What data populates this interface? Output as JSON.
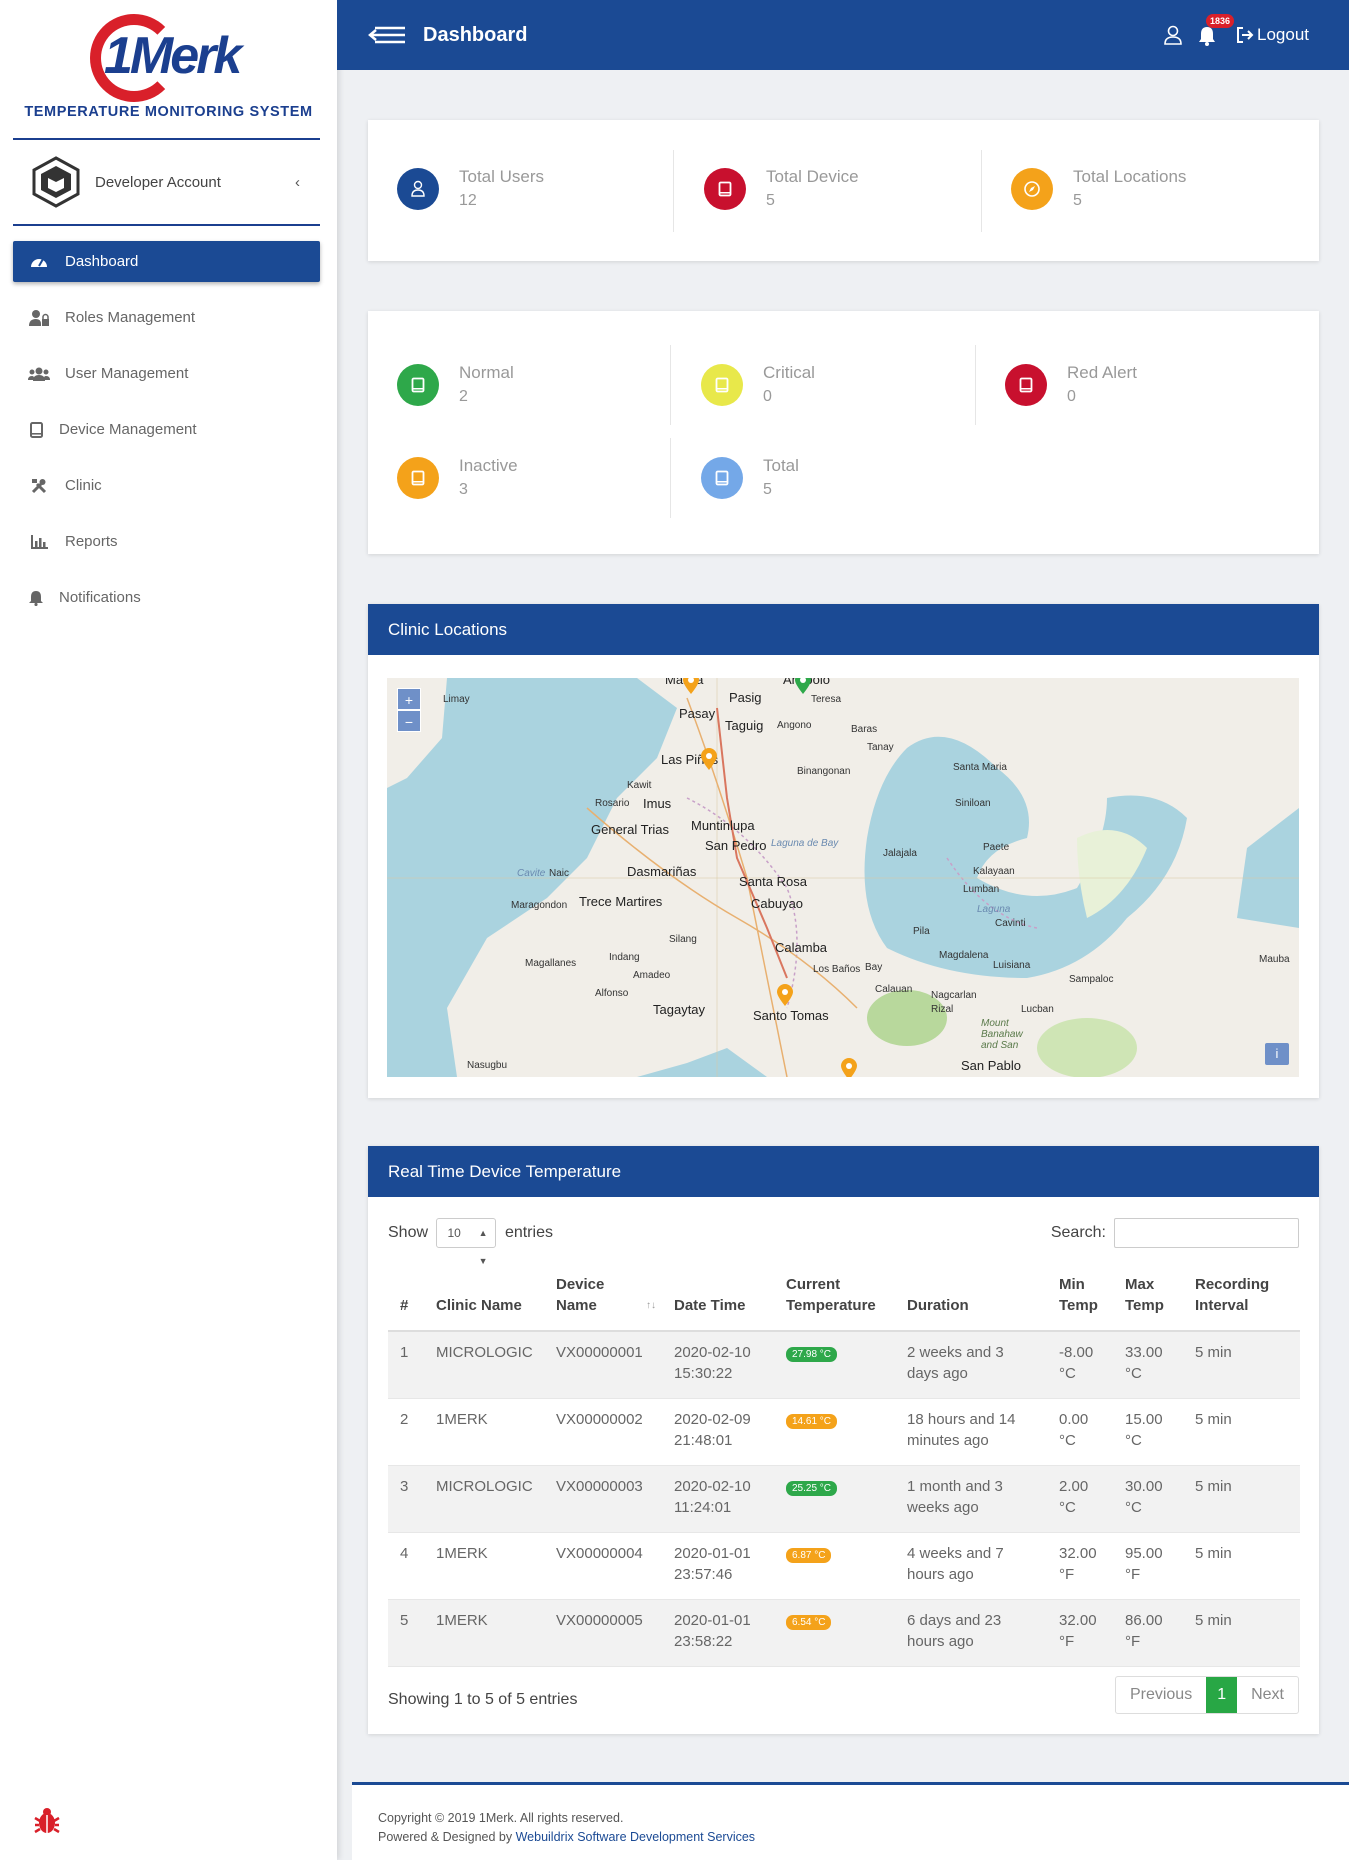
{
  "brand": {
    "logo_text": "1Merk",
    "subtitle": "TEMPERATURE MONITORING SYSTEM"
  },
  "account": {
    "name": "Developer Account",
    "toggle": "‹"
  },
  "sidebar": {
    "items": [
      {
        "label": "Dashboard",
        "icon": "tachometer-icon",
        "active": true
      },
      {
        "label": "Roles Management",
        "icon": "user-lock-icon",
        "active": false
      },
      {
        "label": "User Management",
        "icon": "users-icon",
        "active": false
      },
      {
        "label": "Device Management",
        "icon": "tablet-icon",
        "active": false
      },
      {
        "label": "Clinic",
        "icon": "tools-icon",
        "active": false
      },
      {
        "label": "Reports",
        "icon": "bar-chart-icon",
        "active": false
      },
      {
        "label": "Notifications",
        "icon": "bell-icon",
        "active": false
      }
    ]
  },
  "header": {
    "title": "Dashboard",
    "notification_count": "1836",
    "logout_label": "Logout"
  },
  "summary": [
    {
      "label": "Total Users",
      "value": "12",
      "color": "#1b4a94",
      "icon": "user-icon"
    },
    {
      "label": "Total Device",
      "value": "5",
      "color": "#c8102e",
      "icon": "tablet-icon"
    },
    {
      "label": "Total Locations",
      "value": "5",
      "color": "#f4a21a",
      "icon": "compass-icon"
    }
  ],
  "status": [
    {
      "label": "Normal",
      "value": "2",
      "color": "#2ea84a",
      "icon": "tablet-icon"
    },
    {
      "label": "Critical",
      "value": "0",
      "color": "#e8e84a",
      "icon": "tablet-icon"
    },
    {
      "label": "Red Alert",
      "value": "0",
      "color": "#c8102e",
      "icon": "tablet-icon"
    },
    {
      "label": "Inactive",
      "value": "3",
      "color": "#f4a21a",
      "icon": "tablet-icon"
    },
    {
      "label": "Total",
      "value": "5",
      "color": "#74a8e8",
      "icon": "tablet-icon"
    }
  ],
  "map": {
    "title": "Clinic Locations",
    "zoom_in": "+",
    "zoom_out": "−",
    "info": "i",
    "places": [
      "Manila",
      "Pasig",
      "Antipolo",
      "Teresa",
      "Pasay",
      "Taguig",
      "Angono",
      "Baras",
      "Tanay",
      "Limay",
      "Las Piñas",
      "Binangonan",
      "Santa Maria",
      "Kawit",
      "Imus",
      "Rosario",
      "Siniloan",
      "Muntinlupa",
      "General Trias",
      "San Pedro",
      "Laguna de Bay",
      "Jalajala",
      "Paete",
      "Cavite",
      "Naic",
      "Dasmariñas",
      "Santa Rosa",
      "Kalayaan",
      "Maragondon",
      "Trece Martires",
      "Cabuyao",
      "Lumban",
      "Laguna",
      "Cavinti",
      "Silang",
      "Pila",
      "Calamba",
      "Magallanes",
      "Indang",
      "Los Baños",
      "Bay",
      "Magdalena",
      "Luisiana",
      "Mauba",
      "Amadeo",
      "Sampaloc",
      "Alfonso",
      "Calauan",
      "Nagcarlan",
      "Rizal",
      "Tagaytay",
      "Santo Tomas",
      "Lucban",
      "Mount Banahaw and San",
      "Nasugbu",
      "San Pablo"
    ]
  },
  "device_table": {
    "title": "Real Time Device Temperature",
    "show_label": "Show",
    "page_length": "10",
    "entries_label": "entries",
    "search_label": "Search:",
    "columns": [
      "#",
      "Clinic Name",
      "Device Name",
      "Date Time",
      "Current Temperature",
      "Duration",
      "Min Temp",
      "Max Temp",
      "Recording Interval"
    ],
    "rows": [
      {
        "n": "1",
        "clinic": "MICROLOGIC",
        "device": "VX00000001",
        "datetime": "2020-02-10 15:30:22",
        "temp": "27.98 °C",
        "temp_color": "#2ea84a",
        "duration": "2 weeks and 3 days ago",
        "min": "-8.00 °C",
        "max": "33.00 °C",
        "interval": "5 min"
      },
      {
        "n": "2",
        "clinic": "1MERK",
        "device": "VX00000002",
        "datetime": "2020-02-09 21:48:01",
        "temp": "14.61 °C",
        "temp_color": "#f4a21a",
        "duration": "18 hours and 14 minutes ago",
        "min": "0.00 °C",
        "max": "15.00 °C",
        "interval": "5 min"
      },
      {
        "n": "3",
        "clinic": "MICROLOGIC",
        "device": "VX00000003",
        "datetime": "2020-02-10 11:24:01",
        "temp": "25.25 °C",
        "temp_color": "#2ea84a",
        "duration": "1 month and 3 weeks ago",
        "min": "2.00 °C",
        "max": "30.00 °C",
        "interval": "5 min"
      },
      {
        "n": "4",
        "clinic": "1MERK",
        "device": "VX00000004",
        "datetime": "2020-01-01 23:57:46",
        "temp": "6.87 °C",
        "temp_color": "#f4a21a",
        "duration": "4 weeks and 7 hours ago",
        "min": "32.00 °F",
        "max": "95.00 °F",
        "interval": "5 min"
      },
      {
        "n": "5",
        "clinic": "1MERK",
        "device": "VX00000005",
        "datetime": "2020-01-01 23:58:22",
        "temp": "6.54 °C",
        "temp_color": "#f4a21a",
        "duration": "6 days and 23 hours ago",
        "min": "32.00 °F",
        "max": "86.00 °F",
        "interval": "5 min"
      }
    ],
    "info": "Showing 1 to 5 of 5 entries",
    "pager": {
      "previous": "Previous",
      "current": "1",
      "next": "Next"
    }
  },
  "footer": {
    "copyright": "Copyright © 2019 1Merk. All rights reserved.",
    "powered_prefix": "Powered & Designed by",
    "powered_link": "Webuildrix Software Development Services"
  }
}
